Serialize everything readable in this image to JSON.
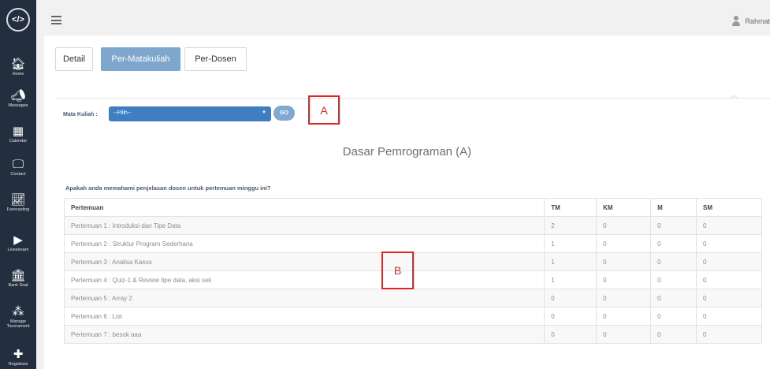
{
  "sidebar": {
    "logo": "</>",
    "items": [
      {
        "icon": "home-icon",
        "glyph": "🏠︎",
        "label": "Home"
      },
      {
        "icon": "megaphone-icon",
        "glyph": "📣︎",
        "label": "Messages"
      },
      {
        "icon": "calendar-icon",
        "glyph": "▦",
        "label": "Calendar"
      },
      {
        "icon": "monitor-icon",
        "glyph": "🖵",
        "label": "Contact"
      },
      {
        "icon": "line-chart-icon",
        "glyph": "📈︎",
        "label": "Forecasting"
      },
      {
        "icon": "play-icon",
        "glyph": "▶",
        "label": "Livestream"
      },
      {
        "icon": "bank-icon",
        "glyph": "🏛︎",
        "label": "Bank Soal"
      },
      {
        "icon": "share-nodes-icon",
        "glyph": "⁂",
        "label": "Manage Tournament"
      },
      {
        "icon": "plus-icon",
        "glyph": "✚",
        "label": "Registrasi"
      }
    ]
  },
  "topbar": {
    "username": "Rahmat"
  },
  "tabs": [
    "Detail",
    "Per-Matakuliah",
    "Per-Dosen"
  ],
  "filter": {
    "label": "Mata Kuliah :",
    "selected": "--Pilih--",
    "go_label": "GO"
  },
  "annotations": {
    "a": "A",
    "b": "B"
  },
  "course_title": "Dasar Pemrograman (A)",
  "question": "Apakah anda memahami penjelasan dosen untuk pertemuan minggu ini?",
  "table": {
    "headers": [
      "Pertemuan",
      "TM",
      "KM",
      "M",
      "SM"
    ],
    "rows": [
      [
        "Pertemuan 1 : Introduksi dan Tipe Data",
        "2",
        "0",
        "0",
        "0"
      ],
      [
        "Pertemuan 2 : Struktur Program Sederhana",
        "1",
        "0",
        "0",
        "0"
      ],
      [
        "Pertemuan 3 : Analisa Kasus",
        "1",
        "0",
        "0",
        "0"
      ],
      [
        "Pertemuan 4 : Quiz-1 & Review tipe data, aksi sek",
        "1",
        "0",
        "0",
        "0"
      ],
      [
        "Pertemuan 5 : Array 2",
        "0",
        "0",
        "0",
        "0"
      ],
      [
        "Pertemuan 6 : List",
        "0",
        "0",
        "0",
        "0"
      ],
      [
        "Pertemuan 7 : besok aaa",
        "0",
        "0",
        "0",
        "0"
      ]
    ]
  }
}
